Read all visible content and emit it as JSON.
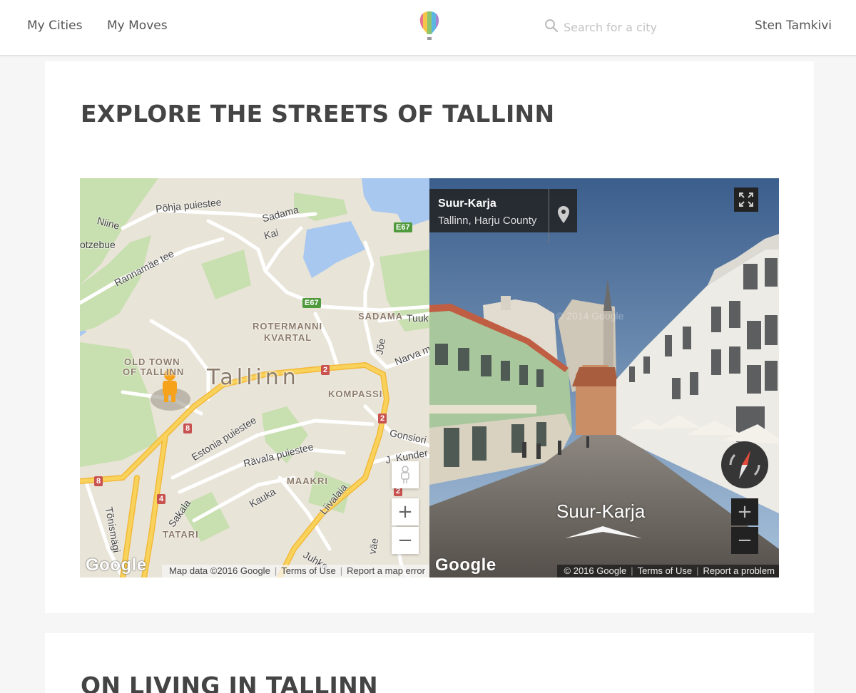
{
  "nav": {
    "my_cities": "My Cities",
    "my_moves": "My Moves",
    "search_placeholder": "Search for a city",
    "user_name": "Sten Tamkivi"
  },
  "section_explore": {
    "title": "EXPLORE THE STREETS OF TALLINN"
  },
  "map": {
    "city_label": "Tallinn",
    "streets": [
      "Põhja puiestee",
      "Sadama",
      "Kai",
      "Niine",
      "otzebue",
      "Rannamäe tee",
      "Estonia puiestee",
      "Rävala puiestee",
      "Kauka",
      "Sakala",
      "Liivalaia",
      "Tõnismägi",
      "Jõe",
      "Narva m",
      "Tuuk",
      "Gonsiori",
      "J. Kunder",
      "Juhke",
      "väe"
    ],
    "districts": [
      "ROTERMANNI",
      "KVARTAL",
      "SADAMA",
      "OLD TOWN",
      "OF TALLINN",
      "KOMPASSI",
      "MAAKRI",
      "TATARI"
    ],
    "shields": {
      "e67_a": "E67",
      "e67_b": "E67",
      "r2_a": "2",
      "r2_b": "2",
      "r2_c": "2",
      "r8_a": "8",
      "r8_b": "8",
      "r4": "4"
    },
    "zoom_in": "+",
    "zoom_out": "−",
    "google": "Google",
    "attribution": [
      "Map data ©2016 Google",
      "Terms of Use",
      "Report a map error"
    ]
  },
  "streetview": {
    "title": "Suur-Karja",
    "subtitle": "Tallinn, Harju County",
    "street_label": "Suur-Karja",
    "watermark": "© 2014 Google",
    "zoom_in": "+",
    "zoom_out": "−",
    "google": "Google",
    "attribution": [
      "© 2016 Google",
      "Terms of Use",
      "Report a problem"
    ]
  },
  "section_living": {
    "title": "ON LIVING IN TALLINN"
  },
  "colors": {
    "accent_text": "#444444",
    "water": "#a8c8f0",
    "park": "#c8dfb0",
    "major_road": "#f9d25c"
  }
}
